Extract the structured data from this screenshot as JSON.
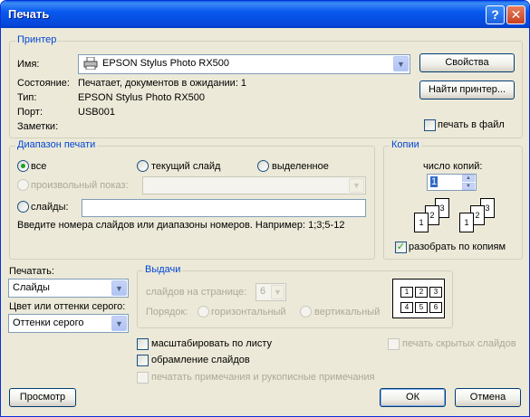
{
  "window": {
    "title": "Печать",
    "help_label": "?",
    "close_label": "✕"
  },
  "printer": {
    "legend": "Принтер",
    "name_label": "Имя:",
    "name_value": "EPSON Stylus Photo RX500",
    "status_label": "Состояние:",
    "status_value": "Печатает, документов в ожидании: 1",
    "type_label": "Тип:",
    "type_value": "EPSON Stylus Photo RX500",
    "port_label": "Порт:",
    "port_value": "USB001",
    "notes_label": "Заметки:",
    "properties_button": "Свойства",
    "find_printer_button": "Найти принтер...",
    "print_to_file_label": "печать в файл",
    "print_to_file_checked": false
  },
  "range": {
    "legend": "Диапазон печати",
    "all_label": "все",
    "current_slide_label": "текущий слайд",
    "selection_label": "выделенное",
    "custom_show_label": "произвольный показ:",
    "slides_label": "слайды:",
    "slides_value": "",
    "hint": "Введите номера слайдов или диапазоны номеров. Например: 1;3;5-12",
    "selected": "all"
  },
  "copies": {
    "legend": "Копии",
    "count_label": "число копий:",
    "count_value": "1",
    "collate_label": "разобрать по копиям",
    "collate_checked": true,
    "page_labels": [
      "1",
      "2",
      "3",
      "1",
      "2",
      "3"
    ]
  },
  "print_what": {
    "label": "Печатать:",
    "value": "Слайды",
    "color_label": "Цвет или оттенки серого:",
    "color_value": "Оттенки серого"
  },
  "handouts": {
    "legend": "Выдачи",
    "per_page_label": "слайдов на странице:",
    "per_page_value": "6",
    "order_label": "Порядок:",
    "horizontal_label": "горизонтальный",
    "vertical_label": "вертикальный",
    "preview_cells": [
      "1",
      "2",
      "3",
      "4",
      "5",
      "6"
    ]
  },
  "options": {
    "scale_to_fit_label": "масштабировать по листу",
    "frame_slides_label": "обрамление слайдов",
    "print_comments_label": "печатать примечания и рукописные примечания",
    "print_hidden_label": "печать скрытых слайдов"
  },
  "buttons": {
    "preview": "Просмотр",
    "ok": "ОК",
    "cancel": "Отмена"
  },
  "colors": {
    "titlebar": "#0859f0",
    "legend_text": "#0046d5",
    "dialog_bg": "#ece9d8"
  }
}
